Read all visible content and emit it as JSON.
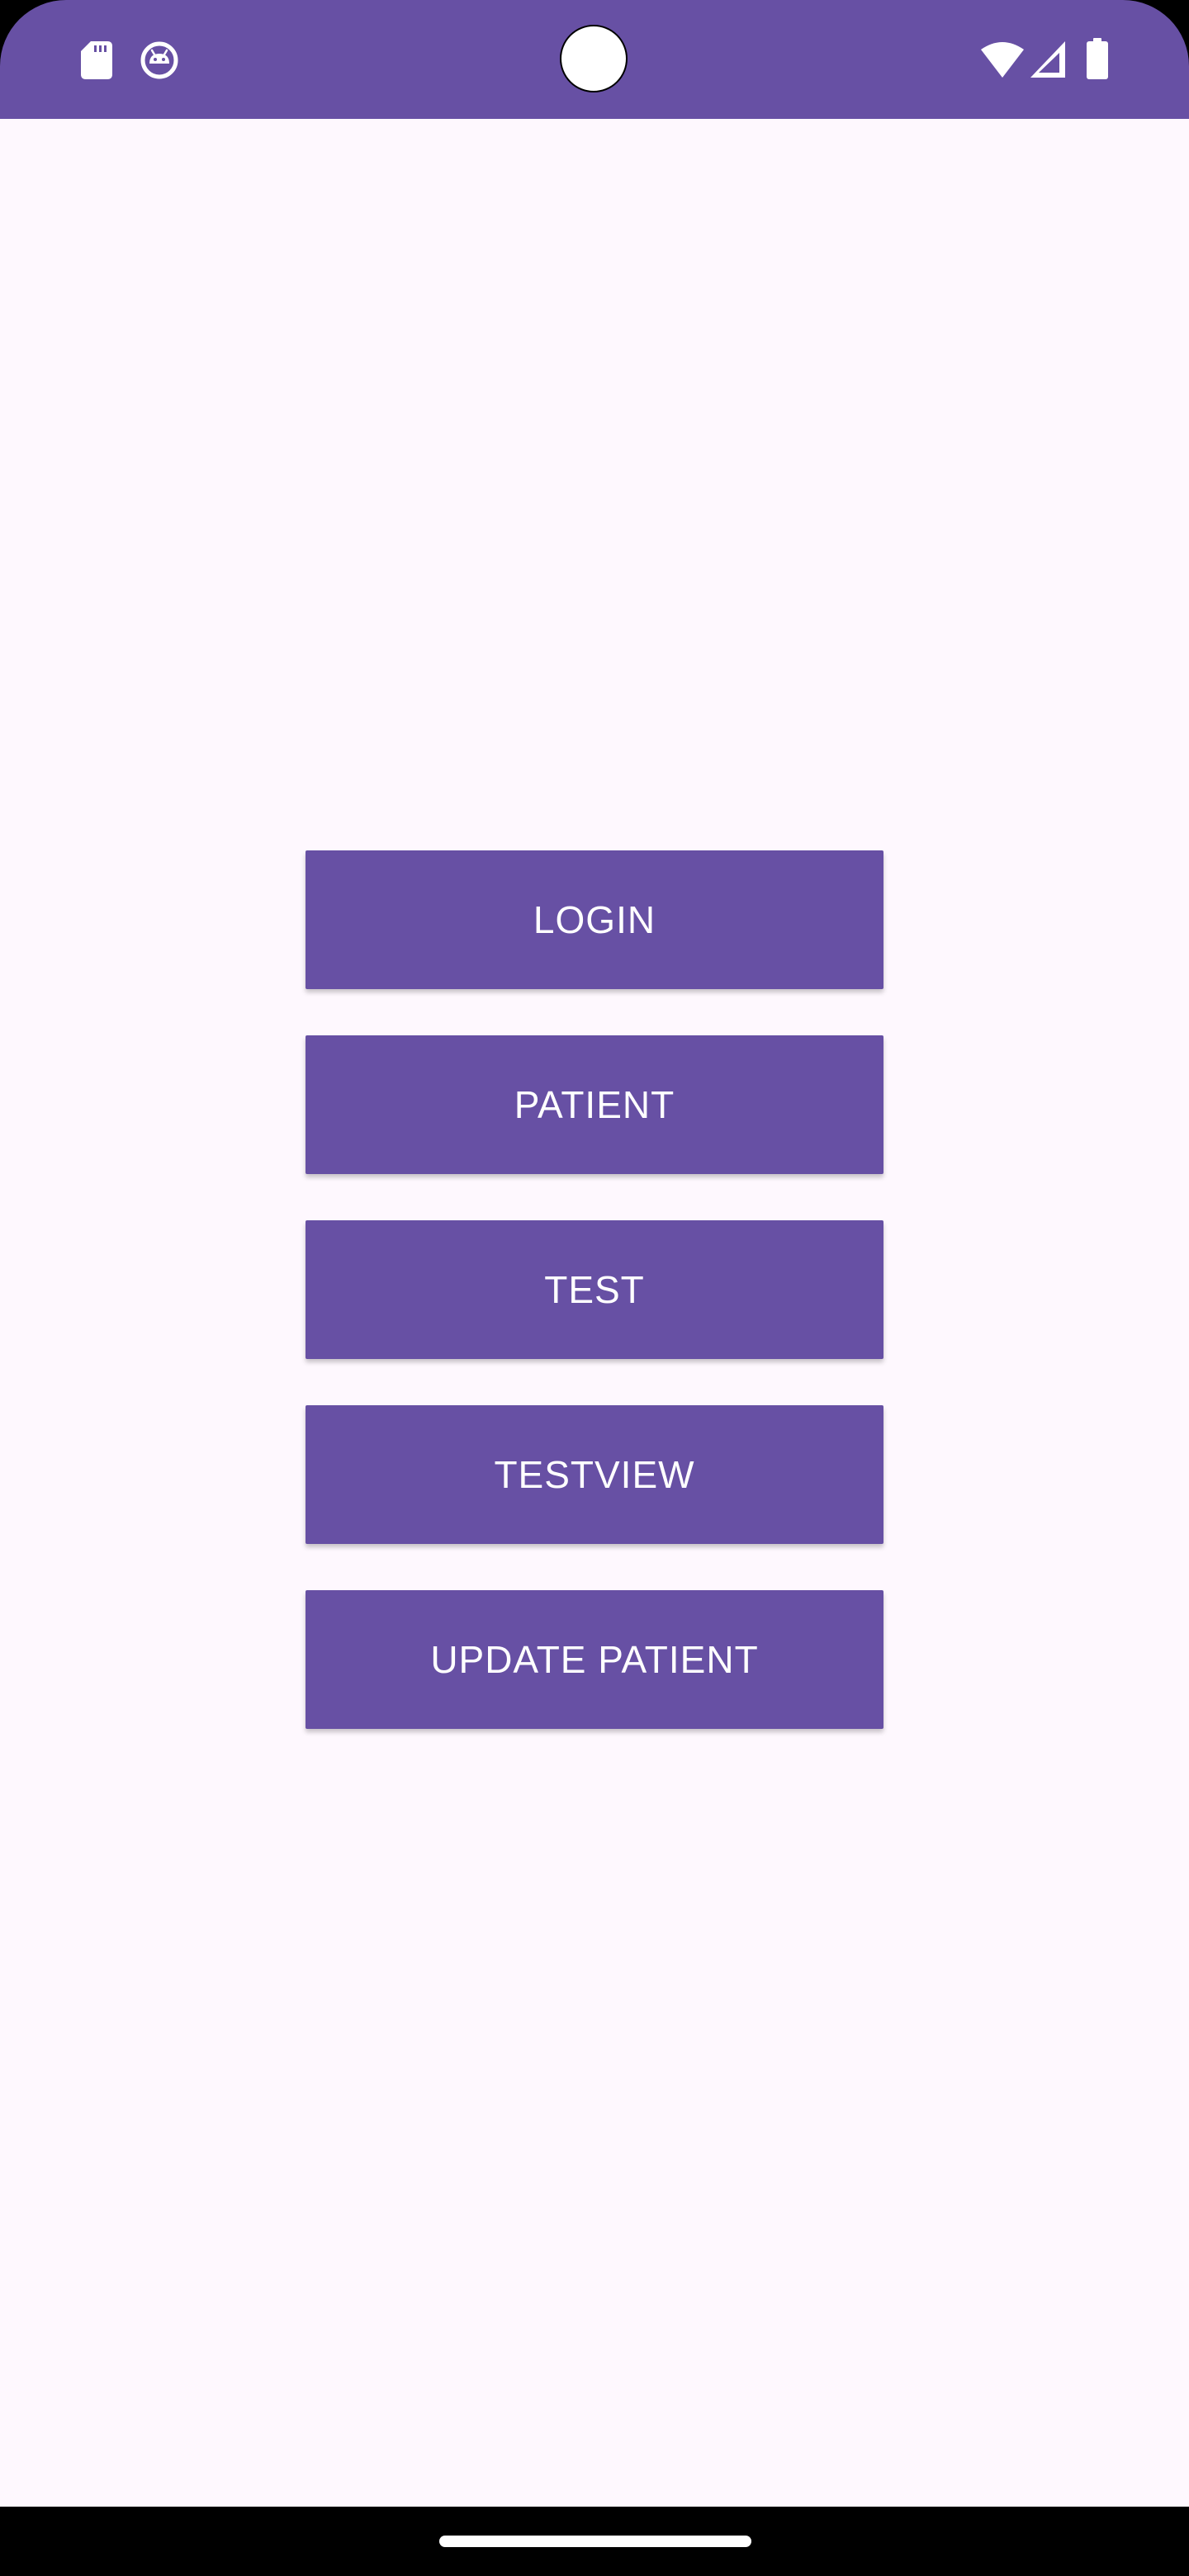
{
  "status_bar": {
    "background_color": "#6750A4",
    "left_icons": [
      "sd-card-icon",
      "android-debug-icon"
    ],
    "center_icon": "camera-cutout",
    "right_icons": [
      "wifi-icon",
      "cellular-signal-icon",
      "battery-icon"
    ]
  },
  "main": {
    "background_color": "#FEF8FE",
    "buttons": [
      {
        "label": "LOGIN"
      },
      {
        "label": "PATIENT"
      },
      {
        "label": "TEST"
      },
      {
        "label": "TESTVIEW"
      },
      {
        "label": "UPDATE PATIENT"
      }
    ],
    "button_color": "#6750A4",
    "button_text_color": "#FFFFFF"
  },
  "nav_bar": {
    "background_color": "#000000",
    "handle": "home-gesture-handle"
  }
}
